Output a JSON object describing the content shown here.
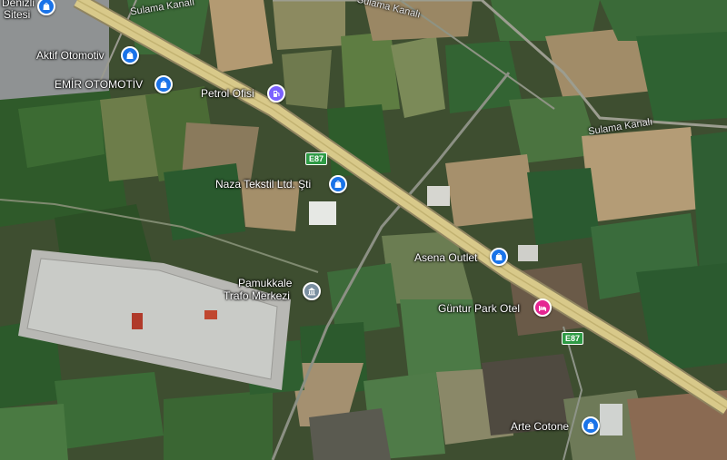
{
  "colors": {
    "shop_pin": "#1a73e8",
    "fuel_pin": "#7b61ff",
    "hotel_pin": "#e52592",
    "gov_pin": "#7a8fa0",
    "highway": "#d8c98a",
    "route_shield": "#2e9a45"
  },
  "places": [
    {
      "name": "Denizli",
      "icon": "shopping-bag-icon"
    },
    {
      "name": "Sitesi"
    },
    {
      "name": "Aktif Otomotiv",
      "icon": "shopping-bag-icon"
    },
    {
      "name": "EMİR OTOMOTİV",
      "icon": "shopping-bag-icon"
    },
    {
      "name": "Petrol Ofisi",
      "icon": "fuel-icon"
    },
    {
      "name": "Naza Tekstil Ltd. Şti",
      "icon": "shopping-bag-icon"
    },
    {
      "name": "Pamukkale",
      "icon": "landmark-icon"
    },
    {
      "name": "Trafo Merkezi"
    },
    {
      "name": "Asena Outlet",
      "icon": "shopping-bag-icon"
    },
    {
      "name": "Güntur Park Otel",
      "icon": "hotel-icon"
    },
    {
      "name": "Arte Cotone",
      "icon": "shopping-bag-icon"
    }
  ],
  "roads": {
    "canal_top": "Sulama Kanalı",
    "canal_top2": "Sulama Kanalı",
    "canal_right": "Sulama Kanalı"
  },
  "routes": {
    "shield1": "E87",
    "shield2": "E87"
  }
}
